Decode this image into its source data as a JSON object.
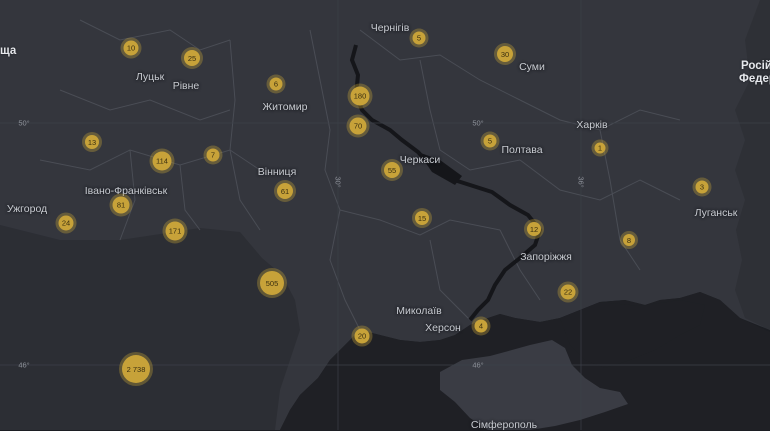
{
  "colors": {
    "background": "#1c1e23",
    "land": "#34363d",
    "sea": "#1f2025",
    "border": "#4a4d55",
    "river": "#15161a",
    "cluster": "#c7a239"
  },
  "countries": {
    "left_partial": "ща",
    "russia_line1": "Росій",
    "russia_line2": "Федер"
  },
  "grid_labels": {
    "lat50_left": "50°",
    "lat50_right": "50°",
    "lat46_left": "46°",
    "lat46_right": "46°",
    "lon30": "30°",
    "lon36": "36°"
  },
  "cities": [
    {
      "id": "chernihiv",
      "name": "Чернігів"
    },
    {
      "id": "lutsk",
      "name": "Луцьк"
    },
    {
      "id": "rivne",
      "name": "Рівне"
    },
    {
      "id": "sumy",
      "name": "Суми"
    },
    {
      "id": "zhytomyr",
      "name": "Житомир"
    },
    {
      "id": "kharkiv",
      "name": "Харків"
    },
    {
      "id": "poltava",
      "name": "Полтава"
    },
    {
      "id": "cherkasy",
      "name": "Черкаси"
    },
    {
      "id": "vinnytsia",
      "name": "Вінниця"
    },
    {
      "id": "ivano",
      "name": "Івано-Франківськ"
    },
    {
      "id": "uzhhorod",
      "name": "Ужгород"
    },
    {
      "id": "luhansk",
      "name": "Луганськ"
    },
    {
      "id": "zaporizhzhia",
      "name": "Запоріжжя"
    },
    {
      "id": "mykolaiv",
      "name": "Миколаїв"
    },
    {
      "id": "kherson",
      "name": "Херсон"
    },
    {
      "id": "simferopol",
      "name": "Сімферополь"
    }
  ],
  "clusters": [
    {
      "id": "c1",
      "count": "10"
    },
    {
      "id": "c2",
      "count": "25"
    },
    {
      "id": "c3",
      "count": "5"
    },
    {
      "id": "c4",
      "count": "30"
    },
    {
      "id": "c5",
      "count": "6"
    },
    {
      "id": "c6",
      "count": "180"
    },
    {
      "id": "c7",
      "count": "70"
    },
    {
      "id": "c8",
      "count": "13"
    },
    {
      "id": "c9",
      "count": "114"
    },
    {
      "id": "c10",
      "count": "7"
    },
    {
      "id": "c11",
      "count": "5"
    },
    {
      "id": "c12",
      "count": "1"
    },
    {
      "id": "c13",
      "count": "55"
    },
    {
      "id": "c14",
      "count": "61"
    },
    {
      "id": "c15",
      "count": "3"
    },
    {
      "id": "c16",
      "count": "81"
    },
    {
      "id": "c17",
      "count": "24"
    },
    {
      "id": "c18",
      "count": "171"
    },
    {
      "id": "c19",
      "count": "15"
    },
    {
      "id": "c20",
      "count": "12"
    },
    {
      "id": "c21",
      "count": "8"
    },
    {
      "id": "c22",
      "count": "505"
    },
    {
      "id": "c23",
      "count": "22"
    },
    {
      "id": "c24",
      "count": "20"
    },
    {
      "id": "c25",
      "count": "4"
    },
    {
      "id": "c26",
      "count": "2 738"
    }
  ]
}
